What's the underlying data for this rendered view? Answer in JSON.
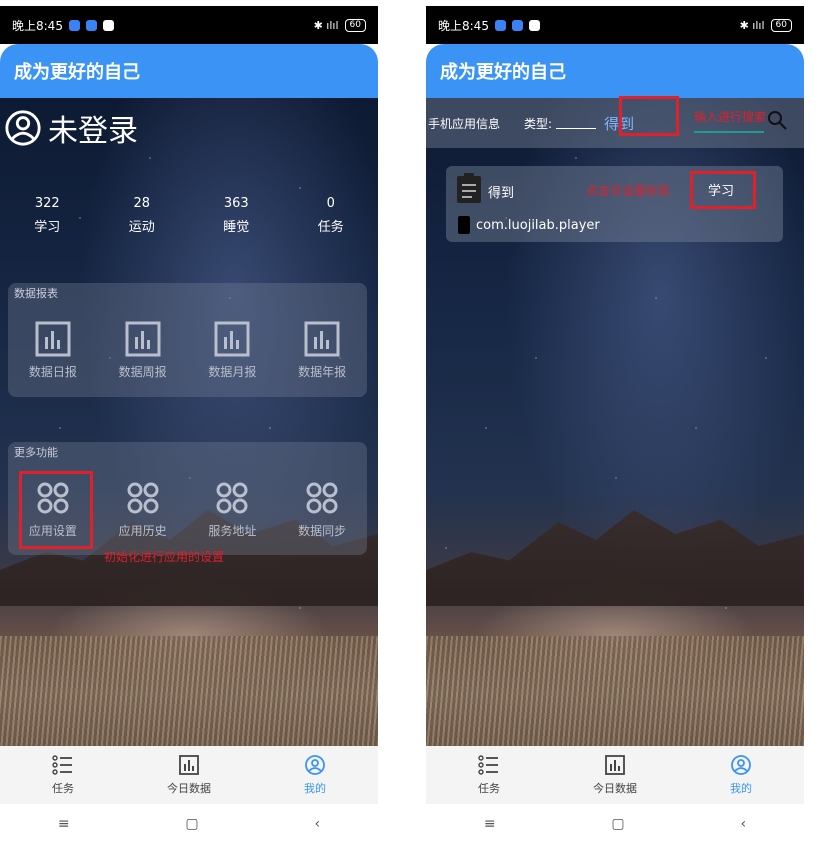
{
  "status_bar": {
    "time": "晚上8:45",
    "signal_text": "✱ ılıl",
    "battery": "60"
  },
  "app_title": "成为更好的自己",
  "screen_profile": {
    "login_text": "未登录",
    "stats": [
      {
        "value": "322",
        "label": "学习"
      },
      {
        "value": "28",
        "label": "运动"
      },
      {
        "value": "363",
        "label": "睡觉"
      },
      {
        "value": "0",
        "label": "任务"
      }
    ],
    "reports_section": {
      "title": "数据报表",
      "items": [
        "数据日报",
        "数据周报",
        "数据月报",
        "数据年报"
      ]
    },
    "more_section": {
      "title": "更多功能",
      "items": [
        "应用设置",
        "应用历史",
        "服务地址",
        "数据同步"
      ]
    },
    "annotation": "初始化进行应用的设置"
  },
  "screen_app_info": {
    "info_label": "手机应用信息",
    "type_label": "类型:",
    "type_chip": "得到",
    "search_annotation": "输入进行搜索",
    "app": {
      "name": "得到",
      "tag_hint": "点击可设置标签",
      "tag": "学习",
      "package": "com.luojilab.player"
    }
  },
  "bottom_nav": {
    "items": [
      {
        "label": "任务",
        "icon": "list-icon"
      },
      {
        "label": "今日数据",
        "icon": "chart-icon"
      },
      {
        "label": "我的",
        "icon": "profile-icon",
        "active": true
      }
    ]
  },
  "system_nav": [
    "≡",
    "▢",
    "‹"
  ]
}
